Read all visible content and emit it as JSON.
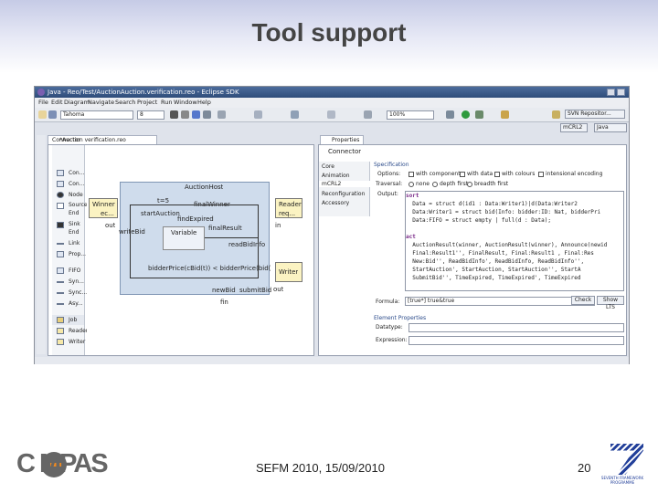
{
  "slide": {
    "title": "Tool support",
    "footer": "SEFM 2010, 15/09/2010",
    "page": "20",
    "logo": "C MPAS",
    "fp7_logo_text": "SEVENTH FRAMEWORK PROGRAMME"
  },
  "window": {
    "title": "Java - Reo/Test/AuctionAuction.verification.reo - Eclipse SDK"
  },
  "menu": [
    "File",
    "Edit",
    "Diagram",
    "Navigate",
    "Search",
    "Project",
    "Run",
    "Window",
    "Help"
  ],
  "toolbar": {
    "font": "Tahoma",
    "size": "8",
    "zoom": "100%",
    "perspective_java": "Java",
    "svn": "SVN Repositor...",
    "mcrl2_btn": "mCRL2"
  },
  "editor": {
    "tab": "*Auction verification.reo",
    "connector": "Connector"
  },
  "palette": {
    "top_items": [
      "Con...",
      "Con...",
      "Node",
      "Source End",
      "Sink End",
      "Link",
      "Prop..."
    ],
    "mid_items": [
      "FIFO",
      "Syn...",
      "Sync...",
      "Asy..."
    ],
    "bottom_header": "Job",
    "bottom_items": [
      "Reader",
      "Writer"
    ]
  },
  "diagram": {
    "main_title": "AuctionHost",
    "winner": "Winner",
    "request": "req...",
    "reader": "Reader",
    "writer": "Writer",
    "labels": [
      "t=5",
      "finalWinner",
      "startAuction",
      "findExpired",
      "Variable",
      "finalResult",
      "readBidInfo",
      "newBid",
      "submitBid",
      "bidderPrice(cBid(t)) < bidderPrice(bid(...)",
      "writeBid",
      "fin",
      "in",
      "out",
      "ec...",
      "out"
    ]
  },
  "properties": {
    "tab": "Properties",
    "header": "Connector",
    "sections": [
      "Core",
      "Animation",
      "mCRL2",
      "Reconfiguration",
      "Accessory"
    ],
    "spec_title": "Specification",
    "options_label": "Options:",
    "opt_with_components": "with components",
    "opt_with_data": "with data",
    "opt_with_colours": "with colours",
    "opt_intensional": "intensional encoding",
    "traversal_label": "Traversal:",
    "trav_none": "none",
    "trav_depth": "depth first",
    "trav_breadth": "breadth first",
    "output_label": "Output:",
    "code_lines": [
      "sort",
      "  Data = struct d(id1 : Data:Writer1)|d(Data:Writer2",
      "  Data:Writer1 = struct bid(Info: bidder:ID: Nat, bidderPri",
      "  Data:FIFO = struct empty | full(d : Data);",
      "",
      "act",
      "  AuctionResult(winner, AuctionResult(winner), Announce(newid",
      "  Final:Result1'', FinalResult, Final:Result1 , Final:Res",
      "  New:Bid'', ReadBidInfo', ReadBidInfo, ReadBidInfo'',",
      "  StartAuction', StartAuction, StartAuction'', StartA",
      "  SubmitBid'', TimeExpired, TimeExpired', TimeExpired"
    ],
    "formula_label": "Formula:",
    "formula_value": "[true*] true&true",
    "check_btn": "Check",
    "show_lts_btn": "Show LTS",
    "element_props": "Element Properties",
    "datatype_label": "Datatype:",
    "expression_label": "Expression:"
  }
}
